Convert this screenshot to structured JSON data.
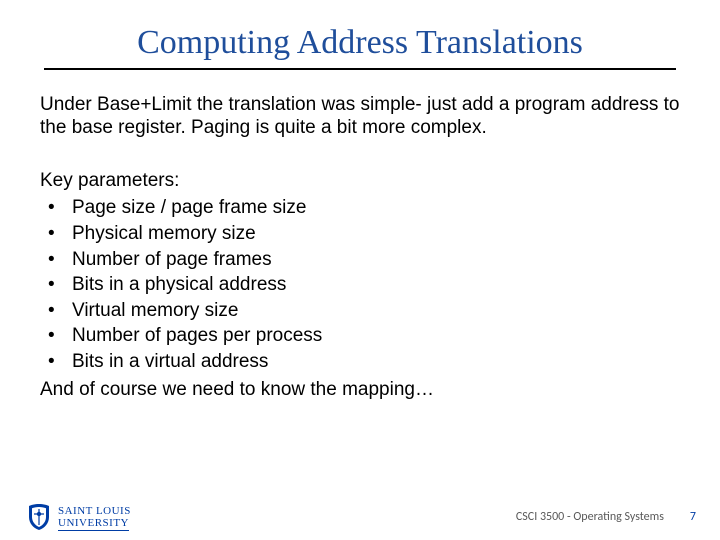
{
  "title": "Computing Address Translations",
  "intro": "Under Base+Limit the translation was simple- just add a program address to the base register. Paging is quite a bit more complex.",
  "params_lead": "Key parameters:",
  "params": [
    "Page size / page frame size",
    "Physical memory size",
    "Number of page frames",
    "Bits in a physical address",
    "Virtual memory size",
    "Number of pages per process",
    "Bits in a virtual address"
  ],
  "params_trail": "And of course we need to know the mapping…",
  "footer": {
    "org_top": "SAINT LOUIS",
    "org_bottom": "UNIVERSITY",
    "course": "CSCI 3500 - Operating Systems",
    "page": "7"
  }
}
